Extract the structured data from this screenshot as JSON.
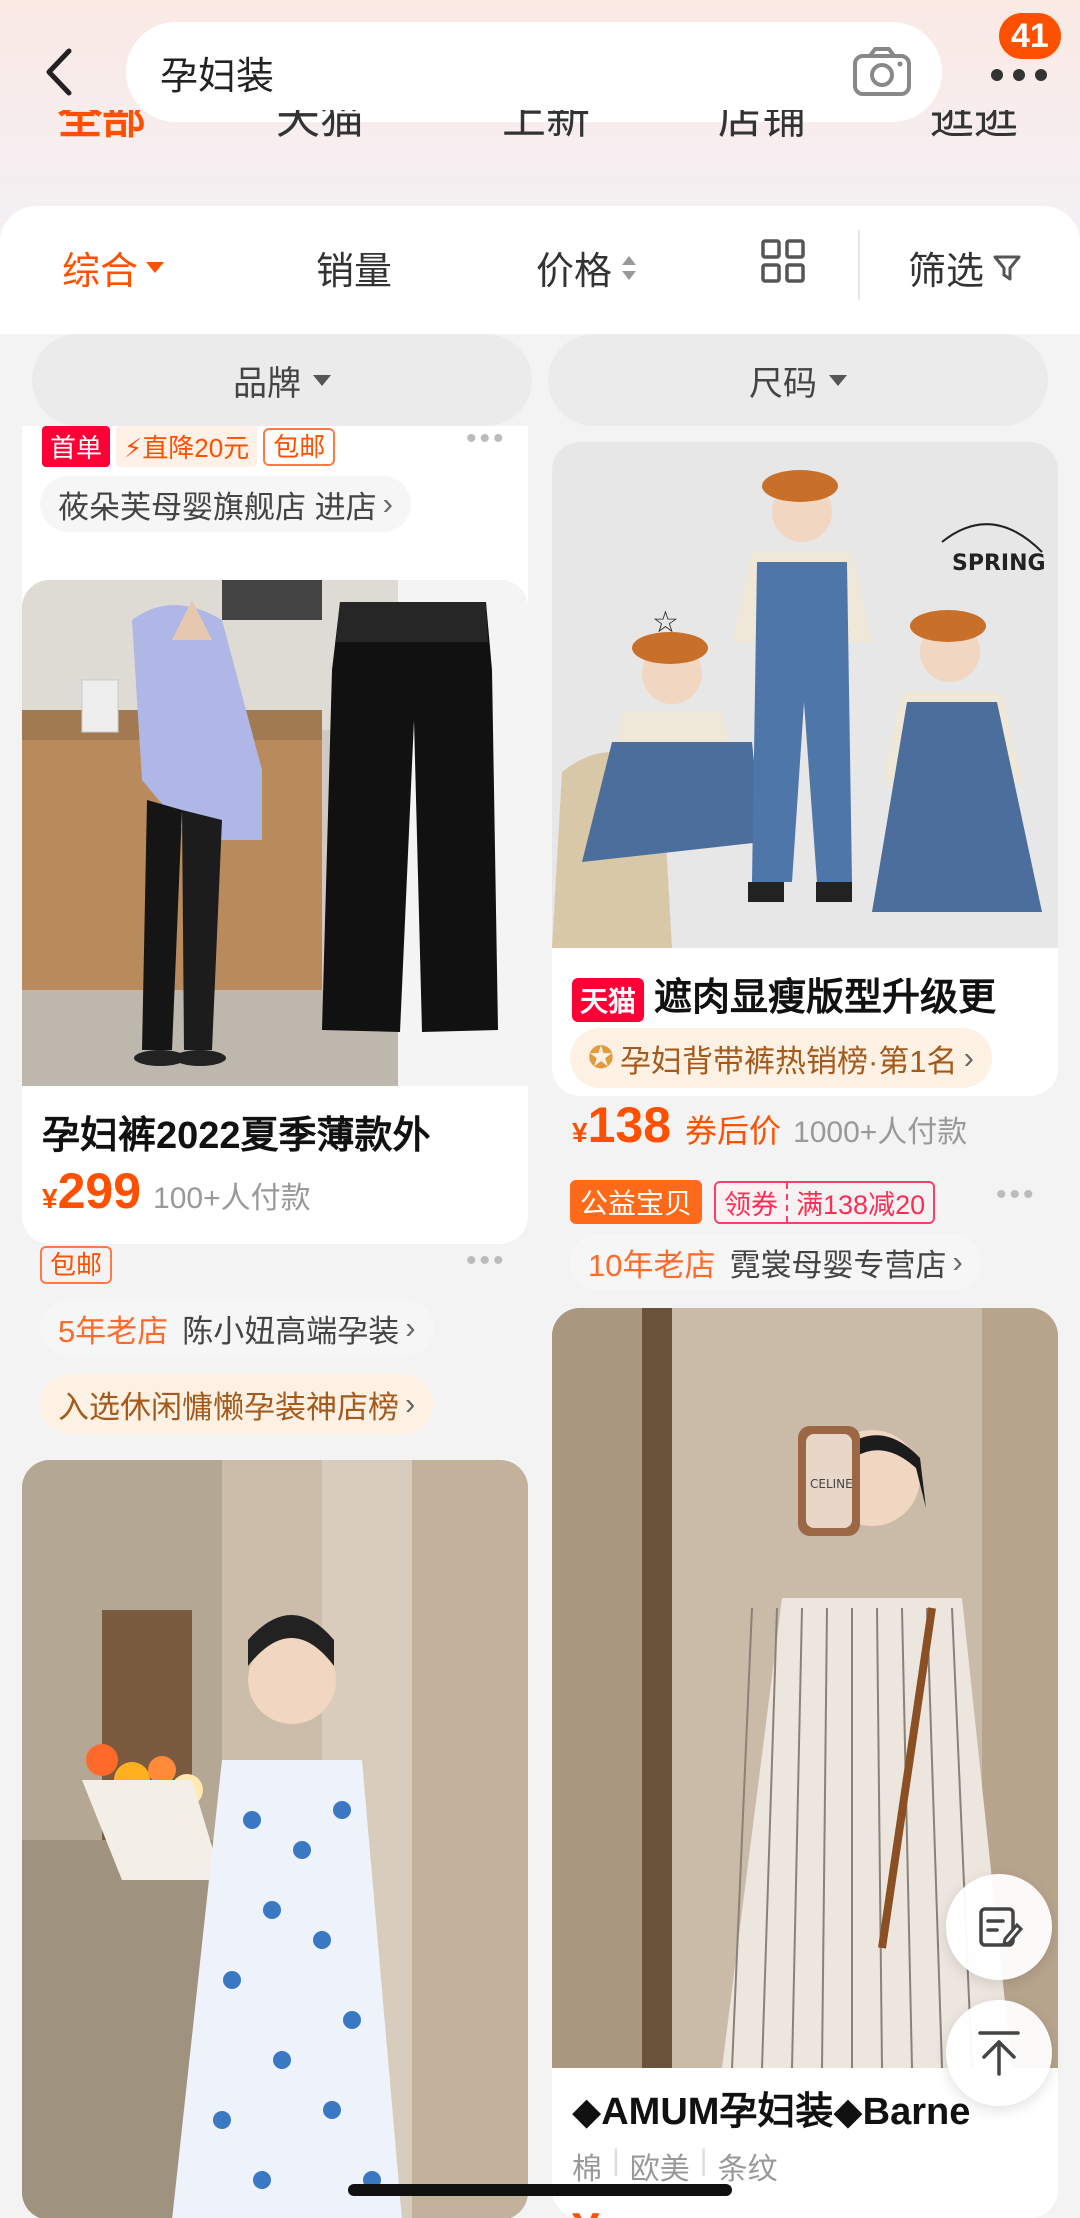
{
  "header": {
    "search_query": "孕妇装",
    "badge_count": "41",
    "tabs": [
      "全部",
      "天猫",
      "上新",
      "店铺",
      "逛逛"
    ]
  },
  "sort_bar": {
    "items": [
      "综合",
      "销量",
      "价格",
      "筛选"
    ]
  },
  "filters": [
    "品牌",
    "尺码"
  ],
  "products": [
    {
      "tags": [
        "首单",
        "直降20元",
        "包邮"
      ],
      "store": "莜朵芙母婴旗舰店 进店"
    },
    {
      "title": "孕妇裤2022夏季薄款外",
      "price": "299",
      "currency": "¥",
      "paid": "100+人付款",
      "shipping_tag": "包邮",
      "store_years": "5年老店",
      "store_name": "陈小妞高端孕装",
      "rank": "入选休闲慵懒孕装神店榜"
    },
    {
      "title": "遮肉显瘦版型升级更",
      "platform_tag": "天猫",
      "rank": "孕妇背带裤热销榜·第1名",
      "price": "138",
      "currency": "¥",
      "price_note": "券后价",
      "paid": "1000+人付款",
      "charity_tag": "公益宝贝",
      "coupon_left": "领券",
      "coupon_right": "满138减20",
      "store_years": "10年老店",
      "store_name": "霓裳母婴专营店",
      "image_text": "SPRING"
    },
    {
      "title": "◆AMUM孕妇装◆Barne",
      "attributes": [
        "棉",
        "欧美",
        "条纹"
      ],
      "image_text": "CELINE"
    },
    {}
  ],
  "icons": [
    "back-arrow-icon",
    "camera-icon",
    "more-dots-icon",
    "grid-view-icon",
    "filter-funnel-icon",
    "edit-note-icon",
    "back-to-top-icon"
  ],
  "colors": {
    "accent": "#ff5000",
    "tmall": "#ff0036"
  }
}
